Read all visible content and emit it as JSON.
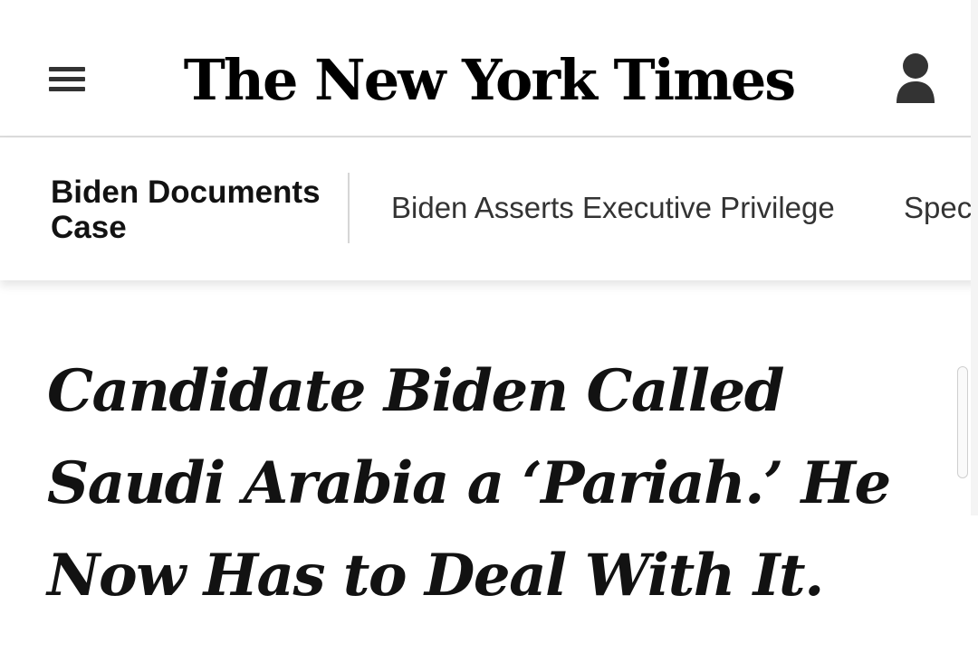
{
  "header": {
    "menu_icon": "hamburger-menu-icon",
    "masthead": "The New York Times",
    "account_icon": "user-account-icon"
  },
  "story_nav": {
    "label": "Biden Documents Case",
    "links": [
      "Biden Asserts Executive Privilege",
      "Spec"
    ]
  },
  "article": {
    "headline": "Candidate Biden Called Saudi Arabia a ‘Pariah.’ He Now Has to Deal With It."
  },
  "colors": {
    "text": "#121212",
    "icon": "#333333",
    "divider": "#d6d6d6"
  }
}
